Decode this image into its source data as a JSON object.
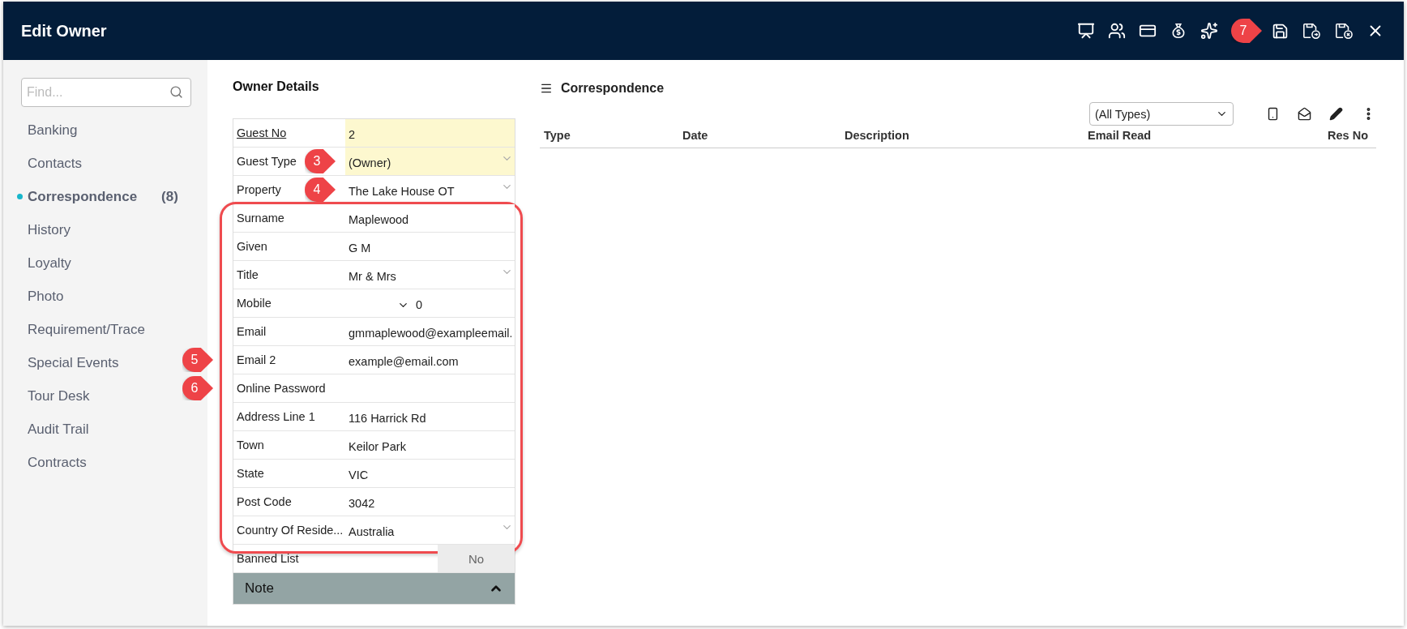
{
  "window": {
    "title": "Edit Owner",
    "callout": "7"
  },
  "sidebar": {
    "search": {
      "placeholder": "Find..."
    },
    "items": [
      {
        "label": "Banking",
        "selected": false
      },
      {
        "label": "Contacts",
        "selected": false
      },
      {
        "label": "Correspondence",
        "selected": true,
        "count": "(8)"
      },
      {
        "label": "History",
        "selected": false
      },
      {
        "label": "Loyalty",
        "selected": false
      },
      {
        "label": "Photo",
        "selected": false
      },
      {
        "label": "Requirement/Trace",
        "selected": false
      },
      {
        "label": "Special Events",
        "selected": false
      },
      {
        "label": "Tour Desk",
        "selected": false
      },
      {
        "label": "Audit Trail",
        "selected": false
      },
      {
        "label": "Contracts",
        "selected": false
      }
    ]
  },
  "owner_details": {
    "title": "Owner Details",
    "sections": [
      {
        "rows": [
          {
            "label": "Guest No",
            "value": "2",
            "kind": "text",
            "highlighted": true,
            "link": true
          },
          {
            "label": "Guest Type",
            "value": "(Owner)",
            "kind": "select",
            "highlighted": true,
            "callout": "3"
          },
          {
            "label": "Property",
            "value": "The Lake House OT",
            "kind": "select",
            "callout": "4"
          }
        ]
      },
      {
        "outlined": true,
        "rows": [
          {
            "label": "Surname",
            "value": "Maplewood",
            "kind": "text"
          },
          {
            "label": "Given",
            "value": "G M",
            "kind": "text"
          },
          {
            "label": "Title",
            "value": "Mr & Mrs",
            "kind": "select"
          },
          {
            "label": "Mobile",
            "value": "0",
            "kind": "phone"
          },
          {
            "label": "Email",
            "value": "gmmaplewood@exampleemail.",
            "kind": "text"
          },
          {
            "label": "Email 2",
            "value": "example@email.com",
            "kind": "text",
            "callout": "5"
          },
          {
            "label": "Online Password",
            "kind": "text",
            "callout": "6"
          },
          {
            "label": "Address Line 1",
            "value": "116 Harrick Rd",
            "kind": "text"
          },
          {
            "label": "Town",
            "value": "Keilor Park",
            "kind": "text"
          },
          {
            "label": "State",
            "value": "VIC",
            "kind": "text"
          },
          {
            "label": "Post Code",
            "value": "3042",
            "kind": "text"
          },
          {
            "label": "Country Of Reside...",
            "value": "Australia",
            "kind": "select"
          }
        ]
      },
      {
        "rows": [
          {
            "label": "Banned List",
            "value": "No",
            "kind": "toggle"
          }
        ]
      }
    ],
    "note": {
      "label": "Note",
      "expanded": true
    }
  },
  "correspondence": {
    "title": "Correspondence",
    "filter": "(All Types)",
    "columns": [
      "Type",
      "Date",
      "Description",
      "Email Read",
      "Res No"
    ]
  }
}
